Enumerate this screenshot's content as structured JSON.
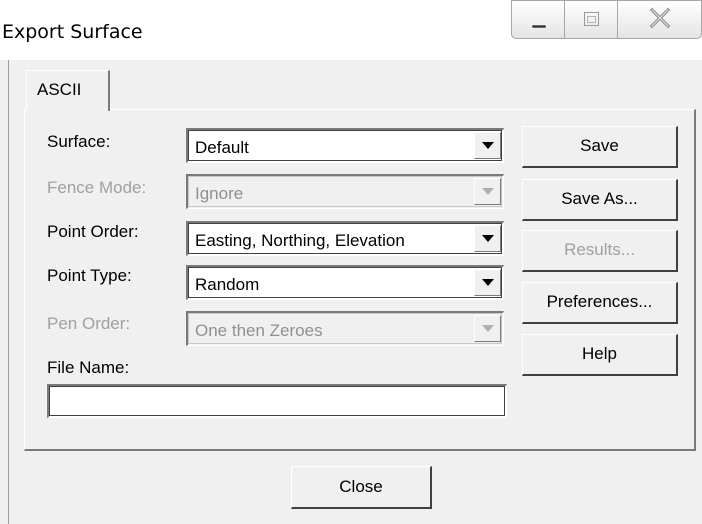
{
  "window": {
    "title": "Export Surface"
  },
  "tabs": [
    {
      "label": "ASCII"
    }
  ],
  "form": {
    "surface": {
      "label": "Surface:",
      "value": "Default"
    },
    "fence_mode": {
      "label": "Fence Mode:",
      "value": "Ignore"
    },
    "point_order": {
      "label": "Point Order:",
      "value": "Easting, Northing, Elevation"
    },
    "point_type": {
      "label": "Point Type:",
      "value": "Random"
    },
    "pen_order": {
      "label": "Pen Order:",
      "value": "One then Zeroes"
    },
    "file_name": {
      "label": "File Name:",
      "value": ""
    }
  },
  "buttons": {
    "save": "Save",
    "save_as": "Save As...",
    "results": "Results...",
    "preferences": "Preferences...",
    "help": "Help",
    "close": "Close"
  },
  "icons": {
    "minimize": "minimize-icon",
    "maximize": "maximize-icon",
    "close": "close-icon",
    "dropdown": "triangle-down-icon"
  }
}
